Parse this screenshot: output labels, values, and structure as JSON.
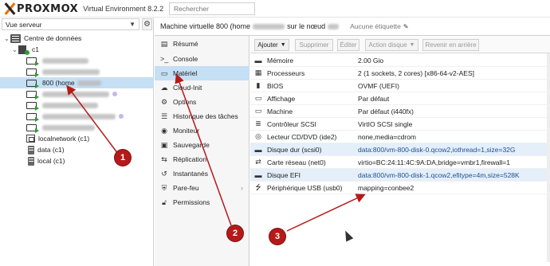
{
  "topbar": {
    "logo_name": "PROXMOX",
    "logo_subtitle": "Virtual Environment 8.2.2",
    "search_placeholder": "Rechercher"
  },
  "left_panel": {
    "view_selector": "Vue serveur",
    "tree": [
      {
        "label": "Centre de données",
        "type": "datacenter"
      },
      {
        "label": "c1",
        "type": "node"
      },
      {
        "label": "",
        "type": "vm",
        "blurred": true
      },
      {
        "label": "",
        "type": "vm",
        "blurred": true
      },
      {
        "label": "800 (home",
        "type": "vm",
        "selected": true,
        "blurred_suffix": true
      },
      {
        "label": "",
        "type": "vm",
        "blurred": true,
        "tag": true
      },
      {
        "label": "",
        "type": "vm",
        "blurred": true
      },
      {
        "label": "",
        "type": "vm",
        "blurred": true,
        "tag": true
      },
      {
        "label": "",
        "type": "vm",
        "blurred": true
      },
      {
        "label": "localnetwork (c1)",
        "type": "network"
      },
      {
        "label": "data (c1)",
        "type": "storage"
      },
      {
        "label": "local (c1)",
        "type": "storage"
      }
    ]
  },
  "header": {
    "title_prefix": "Machine virtuelle 800 (home",
    "title_middle": "sur le nœud",
    "tags": "Aucune étiquette"
  },
  "nav": {
    "items": [
      {
        "label": "Résumé",
        "icon": "summary-icon"
      },
      {
        "label": "Console",
        "icon": "console-icon"
      },
      {
        "label": "Matériel",
        "icon": "hardware-icon",
        "active": true
      },
      {
        "label": "Cloud-Init",
        "icon": "cloud-icon"
      },
      {
        "label": "Options",
        "icon": "gear-icon"
      },
      {
        "label": "Historique des tâches",
        "icon": "list-icon"
      },
      {
        "label": "Moniteur",
        "icon": "eye-icon"
      },
      {
        "label": "Sauvegarde",
        "icon": "backup-icon"
      },
      {
        "label": "Réplication",
        "icon": "replication-icon"
      },
      {
        "label": "Instantanés",
        "icon": "history-icon"
      },
      {
        "label": "Pare-feu",
        "icon": "shield-icon",
        "expandable": true
      },
      {
        "label": "Permissions",
        "icon": "unlock-icon"
      }
    ]
  },
  "toolbar": {
    "add": "Ajouter",
    "remove": "Supprimer",
    "edit": "Éditer",
    "disk_action": "Action disque",
    "revert": "Revenir en arrière"
  },
  "hardware": [
    {
      "name": "Mémoire",
      "value": "2.00 Gio",
      "icon": "memory-icon"
    },
    {
      "name": "Processeurs",
      "value": "2 (1 sockets, 2 cores) [x86-64-v2-AES]",
      "icon": "cpu-icon"
    },
    {
      "name": "BIOS",
      "value": "OVMF (UEFI)",
      "icon": "chip-icon"
    },
    {
      "name": "Affichage",
      "value": "Par défaut",
      "icon": "desktop-icon"
    },
    {
      "name": "Machine",
      "value": "Par défaut (i440fx)",
      "icon": "machine-icon"
    },
    {
      "name": "Contrôleur SCSI",
      "value": "VirtIO SCSI single",
      "icon": "database-icon"
    },
    {
      "name": "Lecteur CD/DVD (ide2)",
      "value": "none,media=cdrom",
      "icon": "cdrom-icon"
    },
    {
      "name": "Disque dur (scsi0)",
      "value": "data:800/vm-800-disk-0.qcow2,iothread=1,size=32G",
      "icon": "harddisk-icon"
    },
    {
      "name": "Carte réseau (net0)",
      "value": "virtio=BC:24:11:4C:9A:DA,bridge=vmbr1,firewall=1",
      "icon": "network-icon"
    },
    {
      "name": "Disque EFI",
      "value": "data:800/vm-800-disk-1.qcow2,efitype=4m,size=528K",
      "icon": "harddisk-icon"
    },
    {
      "name": "Périphérique USB (usb0)",
      "value": "mapping=conbee2",
      "icon": "usb-icon"
    }
  ],
  "annotations": [
    {
      "number": "1"
    },
    {
      "number": "2"
    },
    {
      "number": "3"
    }
  ],
  "colors": {
    "brand_orange": "#e57000",
    "selection_blue": "#c5dff5",
    "annotation_red": "#b51a19",
    "running_green": "#2d9e2d"
  }
}
